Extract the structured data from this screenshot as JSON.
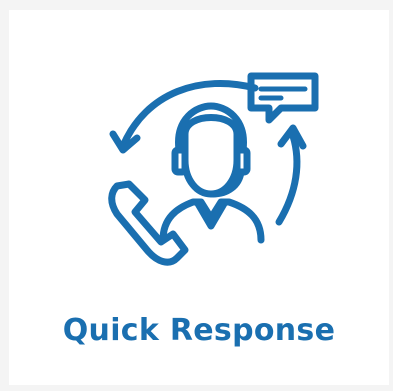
{
  "card": {
    "title": "Quick Response",
    "icon": "customer-support-agent-icon",
    "accent_color": "#1a6fb0"
  }
}
